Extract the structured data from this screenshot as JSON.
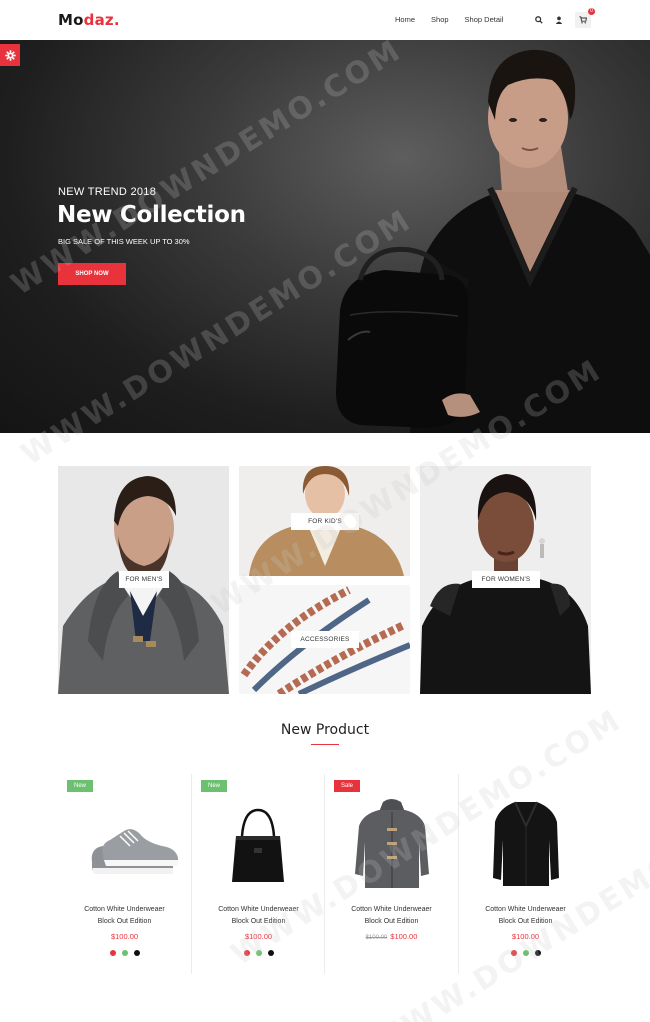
{
  "header": {
    "logo_main": "Mo",
    "logo_accent": "daz.",
    "nav": [
      "Home",
      "Shop",
      "Shop Detail"
    ],
    "cart_count": "0"
  },
  "hero": {
    "kicker": "NEW TREND 2018",
    "title": "New Collection",
    "subtitle": "BIG SALE OF THIS WEEK UP TO 30%",
    "button": "SHOP NOW"
  },
  "categories": {
    "men": "FOR MEN'S",
    "kids": "FOR KID'S",
    "accessories": "ACCESSORIES",
    "women": "FOR WOMEN'S"
  },
  "section_title": "New Product",
  "products": [
    {
      "badge": "New",
      "name_line1": "Cotton White Underweaer",
      "name_line2": "Block Out Edition",
      "old_price": "",
      "price": "$100.00",
      "image": "sneaker"
    },
    {
      "badge": "New",
      "name_line1": "Cotton White Underweaer",
      "name_line2": "Block Out Edition",
      "old_price": "",
      "price": "$100.00",
      "image": "tote-bag"
    },
    {
      "badge": "Sale",
      "name_line1": "Cotton White Underweaer",
      "name_line2": "Block Out Edition",
      "old_price": "$100.00",
      "price": "$100.00",
      "image": "duffle-coat"
    },
    {
      "badge": "",
      "name_line1": "Cotton White Underweaer",
      "name_line2": "Block Out Edition",
      "old_price": "",
      "price": "$100.00",
      "image": "black-coat"
    }
  ],
  "colors": {
    "accent": "#e8333d",
    "badge_new": "#6cc070",
    "badge_sale": "#e8333d",
    "swatch_red": "#e8333d",
    "swatch_green": "#6cc070",
    "swatch_black": "#111111"
  },
  "watermark": "WWW.DOWNDEMO.COM"
}
